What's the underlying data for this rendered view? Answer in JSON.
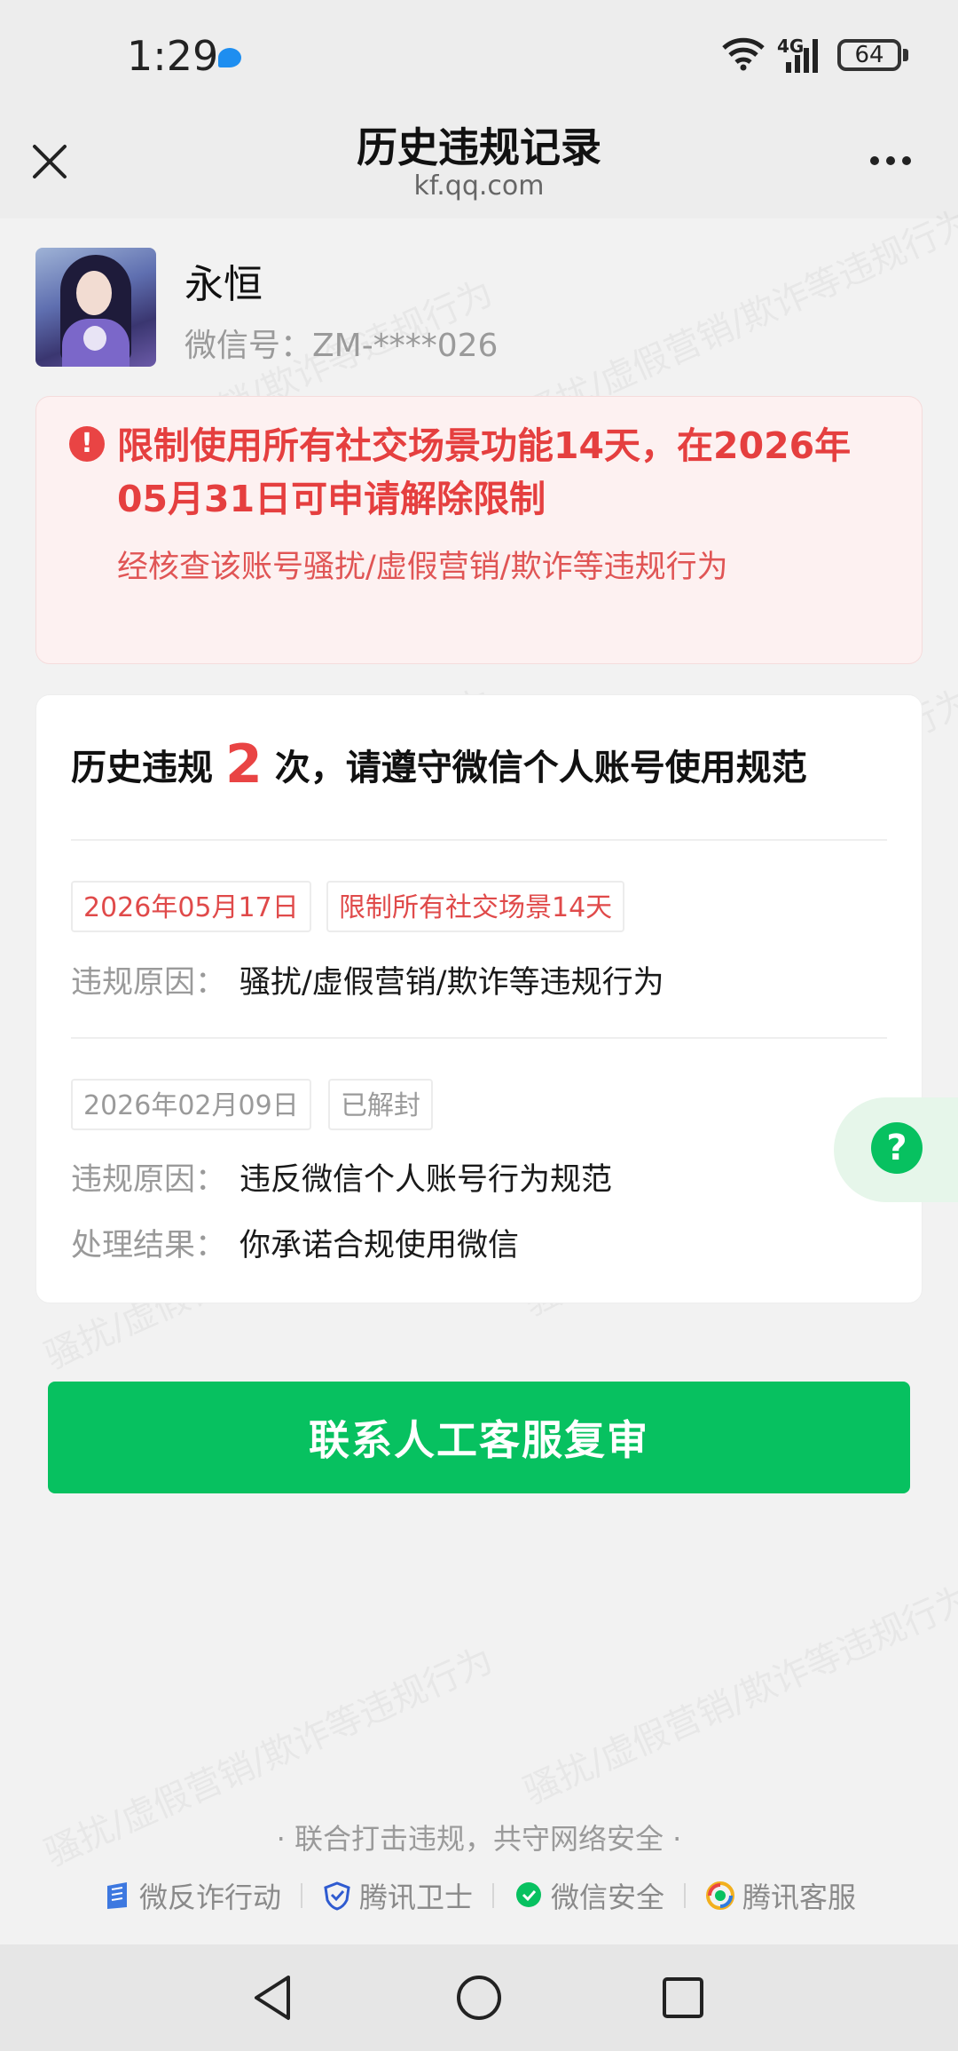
{
  "status_bar": {
    "time": "1:29",
    "network": "4G",
    "battery": "64"
  },
  "nav": {
    "title": "历史违规记录",
    "subtitle": "kf.qq.com"
  },
  "watermark": {
    "text": "骚扰/虚假营销/欺诈等违规行为"
  },
  "profile": {
    "nickname": "永恒",
    "wechat_id": "微信号：ZM-****026"
  },
  "alert": {
    "title": "限制使用所有社交场景功能14天，在2026年05月31日可申请解除限制",
    "desc": "经核查该账号骚扰/虚假营销/欺诈等违规行为"
  },
  "history": {
    "title_prefix": "历史违规",
    "count": "2",
    "title_suffix": "次，请遵守微信个人账号使用规范",
    "records": [
      {
        "date": "2026年05月17日",
        "status": "限制所有社交场景14天",
        "reason_label": "违规原因：",
        "reason": "骚扰/虚假营销/欺诈等违规行为"
      },
      {
        "date": "2026年02月09日",
        "status": "已解封",
        "reason_label": "违规原因：",
        "reason": "违反微信个人账号行为规范",
        "result_label": "处理结果：",
        "result": "你承诺合规使用微信"
      }
    ]
  },
  "help": {
    "icon": "question-icon",
    "glyph": "?"
  },
  "action": {
    "button_label": "联系人工客服复审"
  },
  "footer": {
    "slogan": "· 联合打击违规，共守网络安全 ·",
    "partners": [
      "微反诈行动",
      "腾讯卫士",
      "微信安全",
      "腾讯客服"
    ]
  },
  "colors": {
    "accent": "#07c160",
    "alert_red": "#e53f3f",
    "alert_bg": "#fdf1f1"
  }
}
